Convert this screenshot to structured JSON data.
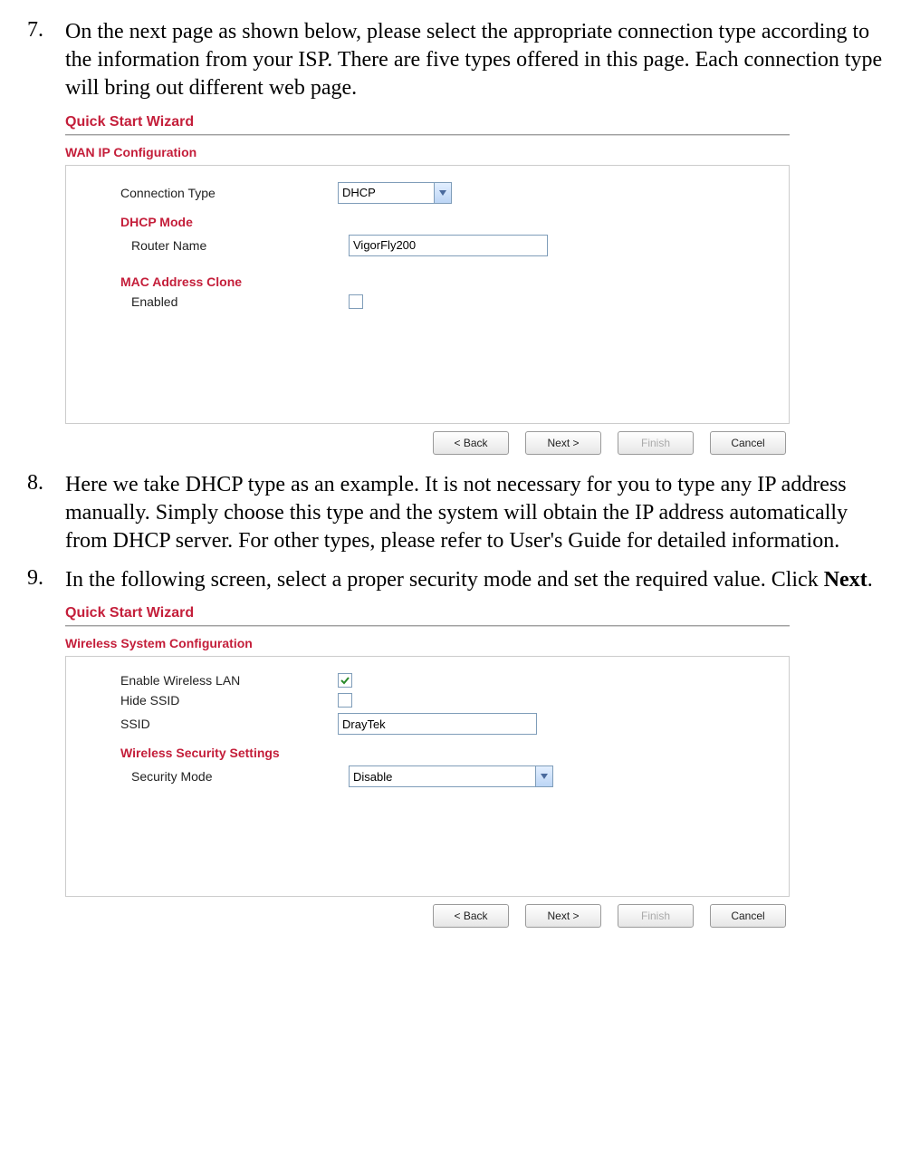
{
  "step7": {
    "number": "7.",
    "text": "On the next page as shown below, please select the appropriate connection type according to the information from your ISP. There are five types offered in this page. Each connection type will bring out different web page."
  },
  "panel1": {
    "title": "Quick Start Wizard",
    "section": "WAN IP Configuration",
    "connection_type_label": "Connection Type",
    "connection_type_value": "DHCP",
    "dhcp_mode_title": "DHCP Mode",
    "router_name_label": "Router Name",
    "router_name_value": "VigorFly200",
    "mac_clone_title": "MAC Address Clone",
    "enabled_label": "Enabled",
    "buttons": {
      "back": "< Back",
      "next": "Next >",
      "finish": "Finish",
      "cancel": "Cancel"
    }
  },
  "step8": {
    "number": "8.",
    "text": "Here we take DHCP type as an example. It is not necessary for you to type any IP address manually. Simply choose this type and the system will obtain the IP address automatically from DHCP server. For other types, please refer to User's Guide for detailed information."
  },
  "step9": {
    "number": "9.",
    "text_pre": "In the following screen, select a proper security mode and set the required value. Click ",
    "text_bold": "Next",
    "text_post": "."
  },
  "panel2": {
    "title": "Quick Start Wizard",
    "section": "Wireless System Configuration",
    "enable_wlan_label": "Enable Wireless LAN",
    "hide_ssid_label": "Hide SSID",
    "ssid_label": "SSID",
    "ssid_value": "DrayTek",
    "security_title": "Wireless Security Settings",
    "security_mode_label": "Security Mode",
    "security_mode_value": "Disable",
    "buttons": {
      "back": "< Back",
      "next": "Next >",
      "finish": "Finish",
      "cancel": "Cancel"
    }
  }
}
